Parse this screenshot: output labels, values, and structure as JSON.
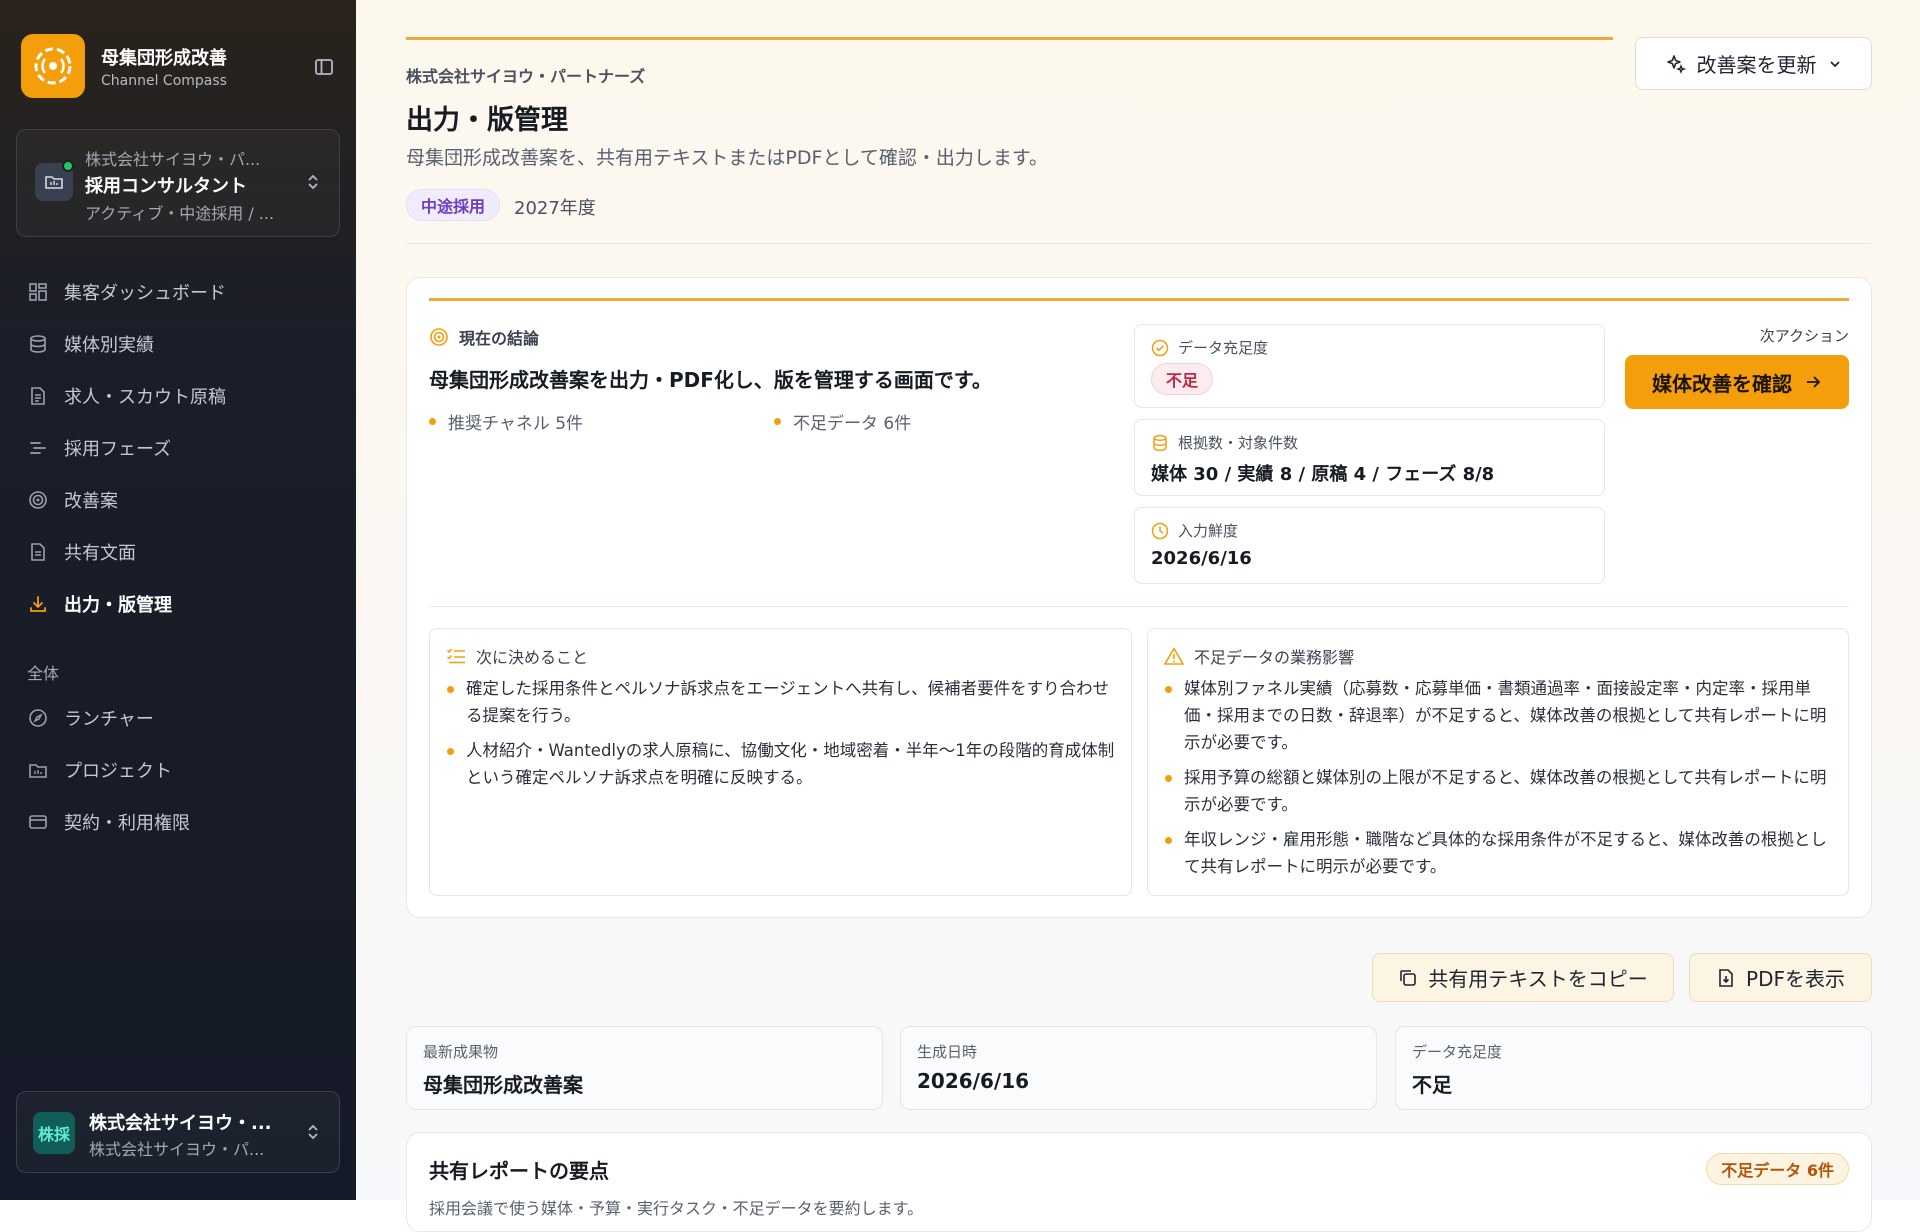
{
  "brand": {
    "title": "母集団形成改善",
    "subtitle": "Channel Compass"
  },
  "workspace": {
    "company": "株式会社サイヨウ・パ...",
    "role": "採用コンサルタント",
    "status": "アクティブ・中途採用 / ..."
  },
  "nav": {
    "items": [
      {
        "label": "集客ダッシュボード",
        "icon": "dashboard-icon"
      },
      {
        "label": "媒体別実績",
        "icon": "database-icon"
      },
      {
        "label": "求人・スカウト原稿",
        "icon": "document-icon"
      },
      {
        "label": "採用フェーズ",
        "icon": "phases-icon"
      },
      {
        "label": "改善案",
        "icon": "target-icon"
      },
      {
        "label": "共有文面",
        "icon": "file-text-icon"
      },
      {
        "label": "出力・版管理",
        "icon": "download-icon",
        "active": true
      }
    ],
    "section_label": "全体",
    "global_items": [
      {
        "label": "ランチャー",
        "icon": "compass-icon"
      },
      {
        "label": "プロジェクト",
        "icon": "folder-icon"
      },
      {
        "label": "契約・利用権限",
        "icon": "card-icon"
      }
    ]
  },
  "account": {
    "badge": "株採",
    "name": "株式会社サイヨウ・...",
    "sub": "株式会社サイヨウ・パ..."
  },
  "header": {
    "company": "株式会社サイヨウ・パートナーズ",
    "title": "出力・版管理",
    "description": "母集団形成改善案を、共有用テキストまたはPDFとして確認・出力します。",
    "tag": "中途採用",
    "year": "2027年度",
    "update_button": "改善案を更新"
  },
  "summary": {
    "conclusion_label": "現在の結論",
    "conclusion_text": "母集団形成改善案を出力・PDF化し、版を管理する画面です。",
    "stat_channels": "推奨チャネル 5件",
    "stat_missing": "不足データ 6件",
    "data_sufficiency_label": "データ充足度",
    "data_sufficiency_value": "不足",
    "evidence_label": "根拠数・対象件数",
    "evidence_value": "媒体 30 / 実績 8 / 原稿 4 / フェーズ 8/8",
    "freshness_label": "入力鮮度",
    "freshness_value": "2026/6/16",
    "next_action_label": "次アクション",
    "next_action_button": "媒体改善を確認"
  },
  "decisions": {
    "title": "次に決めること",
    "items": [
      "確定した採用条件とペルソナ訴求点をエージェントへ共有し、候補者要件をすり合わせる提案を行う。",
      "人材紹介・Wantedlyの求人原稿に、協働文化・地域密着・半年〜1年の段階的育成体制という確定ペルソナ訴求点を明確に反映する。"
    ]
  },
  "impact": {
    "title": "不足データの業務影響",
    "items": [
      "媒体別ファネル実績（応募数・応募単価・書類通過率・面接設定率・内定率・採用単価・採用までの日数・辞退率）が不足すると、媒体改善の根拠として共有レポートに明示が必要です。",
      "採用予算の総額と媒体別の上限が不足すると、媒体改善の根拠として共有レポートに明示が必要です。",
      "年収レンジ・雇用形態・職階など具体的な採用条件が不足すると、媒体改善の根拠として共有レポートに明示が必要です。"
    ]
  },
  "actions": {
    "copy": "共有用テキストをコピー",
    "pdf": "PDFを表示"
  },
  "info": [
    {
      "label": "最新成果物",
      "value": "母集団形成改善案"
    },
    {
      "label": "生成日時",
      "value": "2026/6/16"
    },
    {
      "label": "データ充足度",
      "value": "不足"
    }
  ],
  "report": {
    "title": "共有レポートの要点",
    "badge": "不足データ 6件",
    "sub": "採用会議で使う媒体・予算・実行タスク・不足データを要約します。"
  },
  "colors": {
    "accent": "#f59e0b",
    "sidebar_bg": "#151a28",
    "danger": "#c0283f",
    "purple": "#6d3fc0"
  }
}
